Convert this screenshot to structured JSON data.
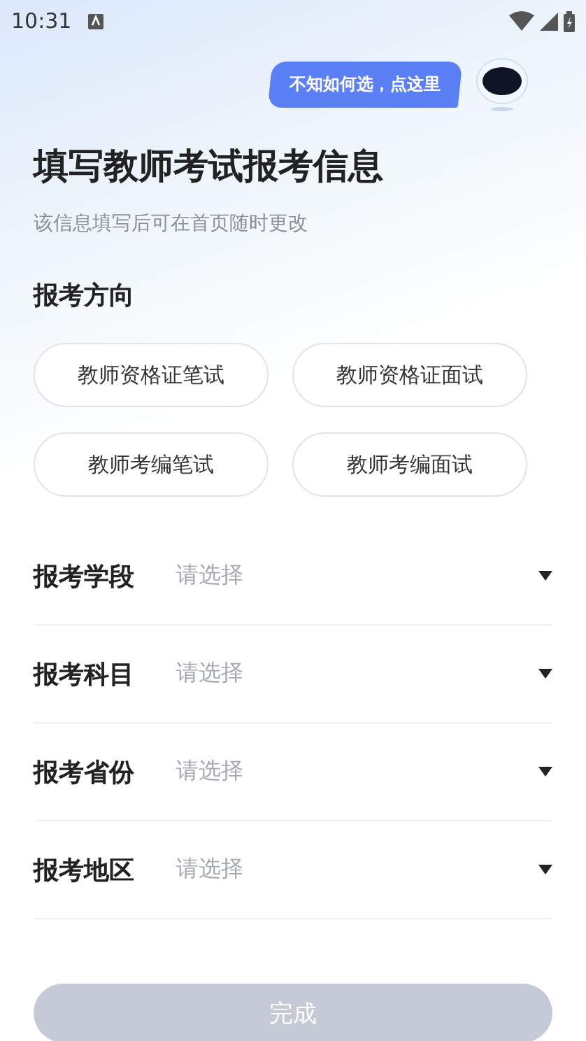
{
  "status_bar": {
    "time": "10:31"
  },
  "helper": {
    "bubble": "不知如何选，点这里"
  },
  "header": {
    "title": "填写教师考试报考信息",
    "subtitle": "该信息填写后可在首页随时更改"
  },
  "direction": {
    "label": "报考方向",
    "options": [
      {
        "label": "教师资格证笔试",
        "selected": false
      },
      {
        "label": "教师资格证面试",
        "selected": false
      },
      {
        "label": "教师考编笔试",
        "selected": false
      },
      {
        "label": "教师考编面试",
        "selected": false
      }
    ]
  },
  "fields": [
    {
      "label": "报考学段",
      "placeholder": "请选择"
    },
    {
      "label": "报考科目",
      "placeholder": "请选择"
    },
    {
      "label": "报考省份",
      "placeholder": "请选择"
    },
    {
      "label": "报考地区",
      "placeholder": "请选择"
    }
  ],
  "submit": {
    "label": "完成",
    "disabled": true
  }
}
